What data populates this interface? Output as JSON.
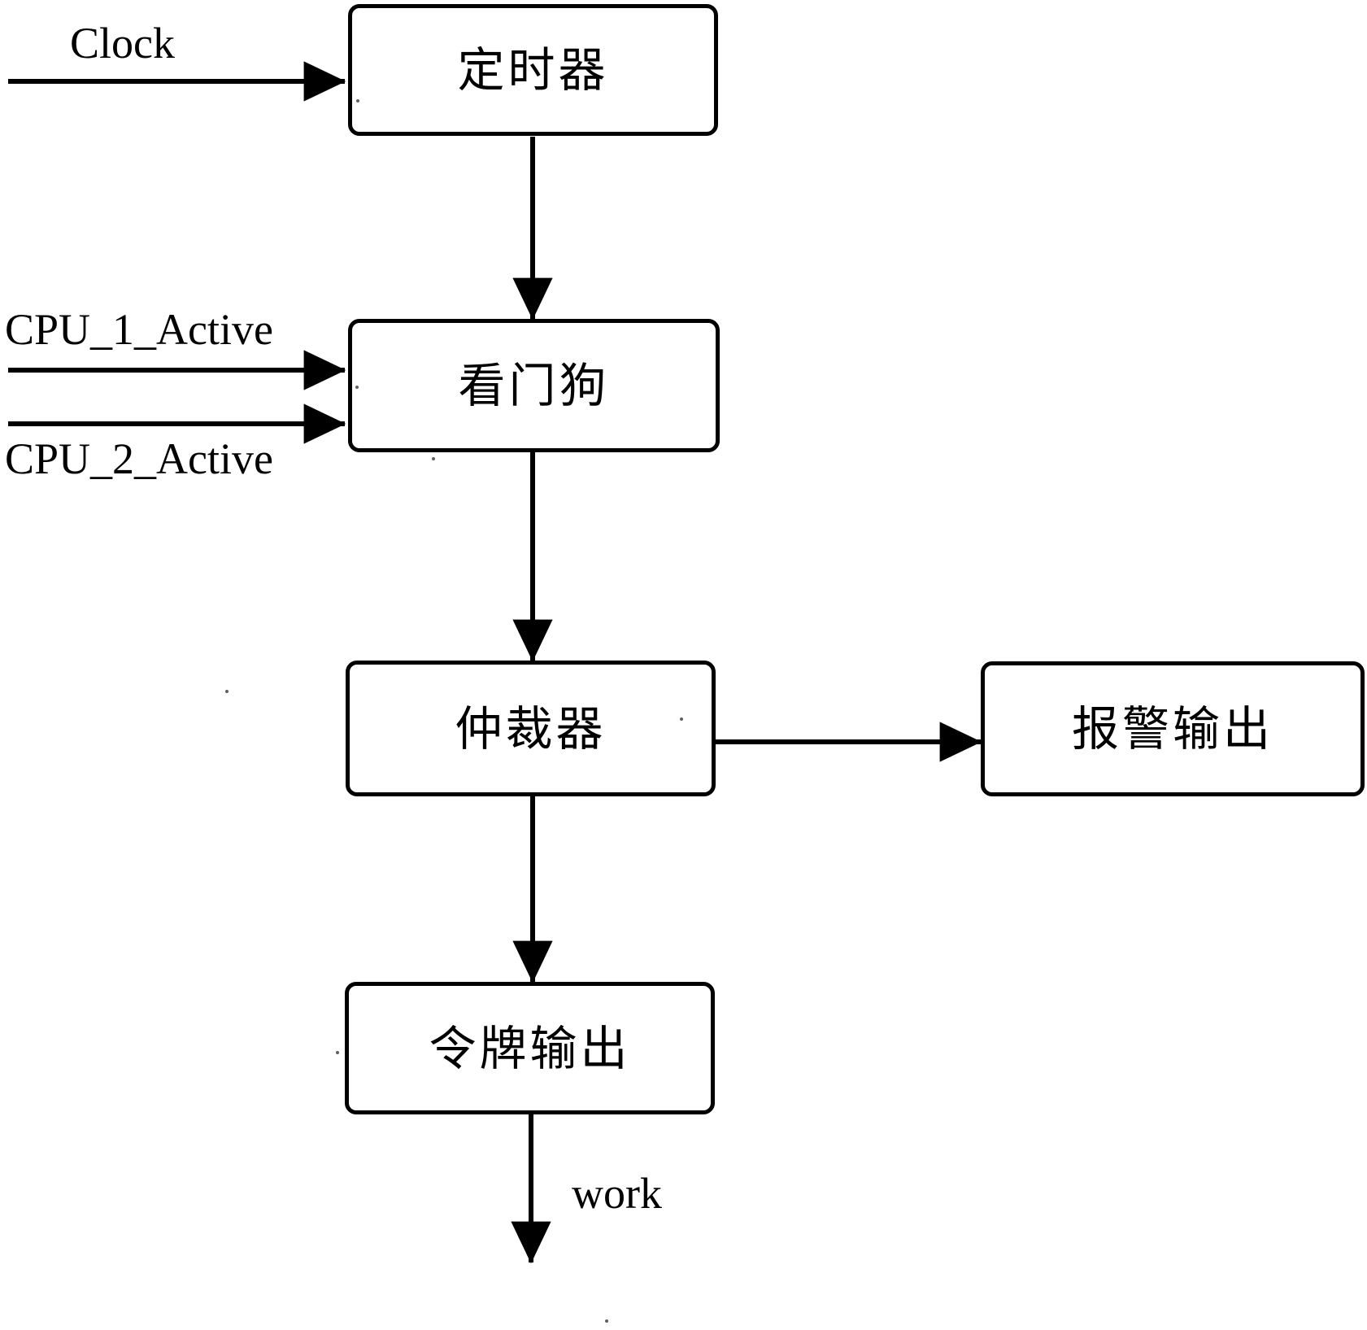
{
  "diagram": {
    "type": "block-diagram",
    "title": "",
    "nodes": [
      {
        "id": "timer",
        "label": "定时器"
      },
      {
        "id": "watchdog",
        "label": "看门狗"
      },
      {
        "id": "arbiter",
        "label": "仲裁器"
      },
      {
        "id": "alarm",
        "label": "报警输出"
      },
      {
        "id": "token",
        "label": "令牌输出"
      }
    ],
    "input_labels": [
      {
        "id": "clock",
        "text": "Clock"
      },
      {
        "id": "cpu1_active",
        "text": "CPU_1_Active"
      },
      {
        "id": "cpu2_active",
        "text": "CPU_2_Active"
      }
    ],
    "output_labels": [
      {
        "id": "work",
        "text": "work"
      }
    ],
    "edges": [
      {
        "from": "clock",
        "to": "timer",
        "label": "Clock"
      },
      {
        "from": "timer",
        "to": "watchdog",
        "label": ""
      },
      {
        "from": "cpu1",
        "to": "watchdog",
        "label": "CPU_1_Active"
      },
      {
        "from": "cpu2",
        "to": "watchdog",
        "label": "CPU_2_Active"
      },
      {
        "from": "watchdog",
        "to": "arbiter",
        "label": ""
      },
      {
        "from": "arbiter",
        "to": "alarm",
        "label": ""
      },
      {
        "from": "arbiter",
        "to": "token",
        "label": ""
      },
      {
        "from": "token",
        "to": "work",
        "label": "work"
      }
    ],
    "colors": {
      "stroke": "#000000",
      "fill": "#ffffff",
      "text": "#000000"
    }
  }
}
